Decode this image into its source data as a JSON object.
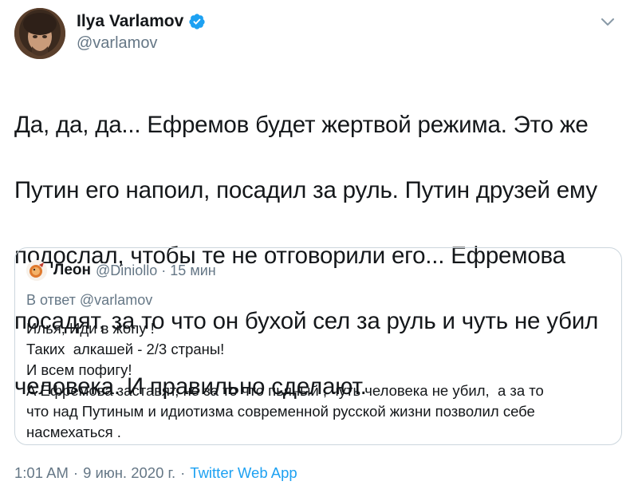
{
  "author": {
    "display_name": "Ilya Varlamov",
    "handle": "@varlamov",
    "verified": true,
    "avatar_icon": "user-avatar"
  },
  "tweet": {
    "lines": [
      "Да, да, да... Ефремов будет жертвой режима. Это же",
      "Путин его напоил, посадил за руль. Путин друзей ему",
      "подослал, чтобы те не отговорили его... Ефремова",
      "посадят, за то что он бухой сел за руль и чуть не убил",
      "человека. И правильно сделают."
    ]
  },
  "quote": {
    "display_name": "Леон",
    "handle": "@Diniollo",
    "separator": "·",
    "time": "15 мин",
    "reply_to_label": "В ответ",
    "reply_to_handle": "@varlamov",
    "lines": [
      "Илья, Иди в жопу !",
      "Таких  алкашей - 2/3 страны!",
      "И всем пофигу!",
      "А Ефремова заставят, не за то что пьяный , чуть человека не убил,  а за то",
      "что над Путиным и идиотизма современной русской жизни позволил себе",
      "насмехаться ."
    ]
  },
  "footer": {
    "time": "1:01 AM",
    "sep1": "·",
    "date": "9 июн. 2020 г.",
    "sep2": "·",
    "source": "Twitter Web App"
  },
  "colors": {
    "text": "#14171a",
    "secondary": "#657786",
    "accent": "#1da1f2",
    "border": "#ccd6dd"
  }
}
